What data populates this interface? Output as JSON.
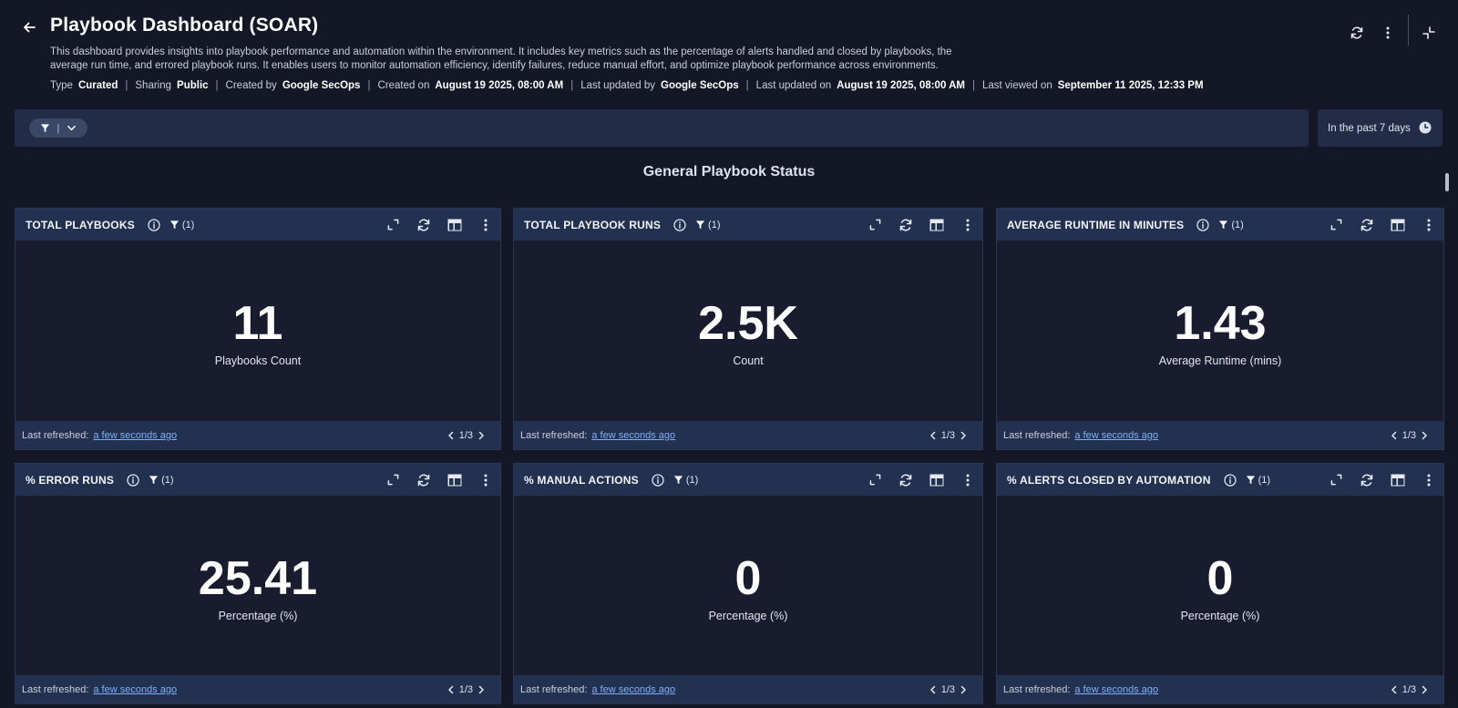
{
  "header": {
    "title": "Playbook Dashboard (SOAR)",
    "description": "This dashboard provides insights into playbook performance and automation within the environment. It includes key metrics such as the percentage of alerts handled and closed by playbooks, the average run time, and errored playbook runs. It enables users to monitor automation efficiency, identify failures, reduce manual effort, and optimize playbook performance across environments.",
    "meta": {
      "type_label": "Type",
      "type_value": "Curated",
      "sharing_label": "Sharing",
      "sharing_value": "Public",
      "created_by_label": "Created by",
      "created_by_value": "Google SecOps",
      "created_on_label": "Created on",
      "created_on_value": "August 19 2025, 08:00 AM",
      "updated_by_label": "Last updated by",
      "updated_by_value": "Google SecOps",
      "updated_on_label": "Last updated on",
      "updated_on_value": "August 19 2025, 08:00 AM",
      "viewed_on_label": "Last viewed on",
      "viewed_on_value": "September 11 2025, 12:33 PM"
    },
    "actions": [
      "refresh-icon",
      "more-vert-icon",
      "collapse-icon"
    ]
  },
  "filterbar": {
    "pipe": "|",
    "time_range": "In the past 7 days"
  },
  "section_title": "General Playbook Status",
  "colors": {
    "background": "#141726",
    "card_header": "#233150",
    "link": "#7fb0f5"
  },
  "cards": [
    {
      "title": "TOTAL PLAYBOOKS",
      "filter_count": "(1)",
      "value": "11",
      "label": "Playbooks Count",
      "refreshed_label": "Last refreshed:",
      "refreshed_value": "a few seconds ago",
      "page": "1/3"
    },
    {
      "title": "TOTAL PLAYBOOK RUNS",
      "filter_count": "(1)",
      "value": "2.5K",
      "label": "Count",
      "refreshed_label": "Last refreshed:",
      "refreshed_value": "a few seconds ago",
      "page": "1/3"
    },
    {
      "title": "AVERAGE RUNTIME IN MINUTES",
      "filter_count": "(1)",
      "value": "1.43",
      "label": "Average Runtime (mins)",
      "refreshed_label": "Last refreshed:",
      "refreshed_value": "a few seconds ago",
      "page": "1/3"
    },
    {
      "title": "% ERROR RUNS",
      "filter_count": "(1)",
      "value": "25.41",
      "label": "Percentage (%)",
      "refreshed_label": "Last refreshed:",
      "refreshed_value": "a few seconds ago",
      "page": "1/3"
    },
    {
      "title": "% MANUAL ACTIONS",
      "filter_count": "(1)",
      "value": "0",
      "label": "Percentage (%)",
      "refreshed_label": "Last refreshed:",
      "refreshed_value": "a few seconds ago",
      "page": "1/3"
    },
    {
      "title": "% ALERTS CLOSED BY AUTOMATION",
      "filter_count": "(1)",
      "value": "0",
      "label": "Percentage (%)",
      "refreshed_label": "Last refreshed:",
      "refreshed_value": "a few seconds ago",
      "page": "1/3"
    }
  ]
}
